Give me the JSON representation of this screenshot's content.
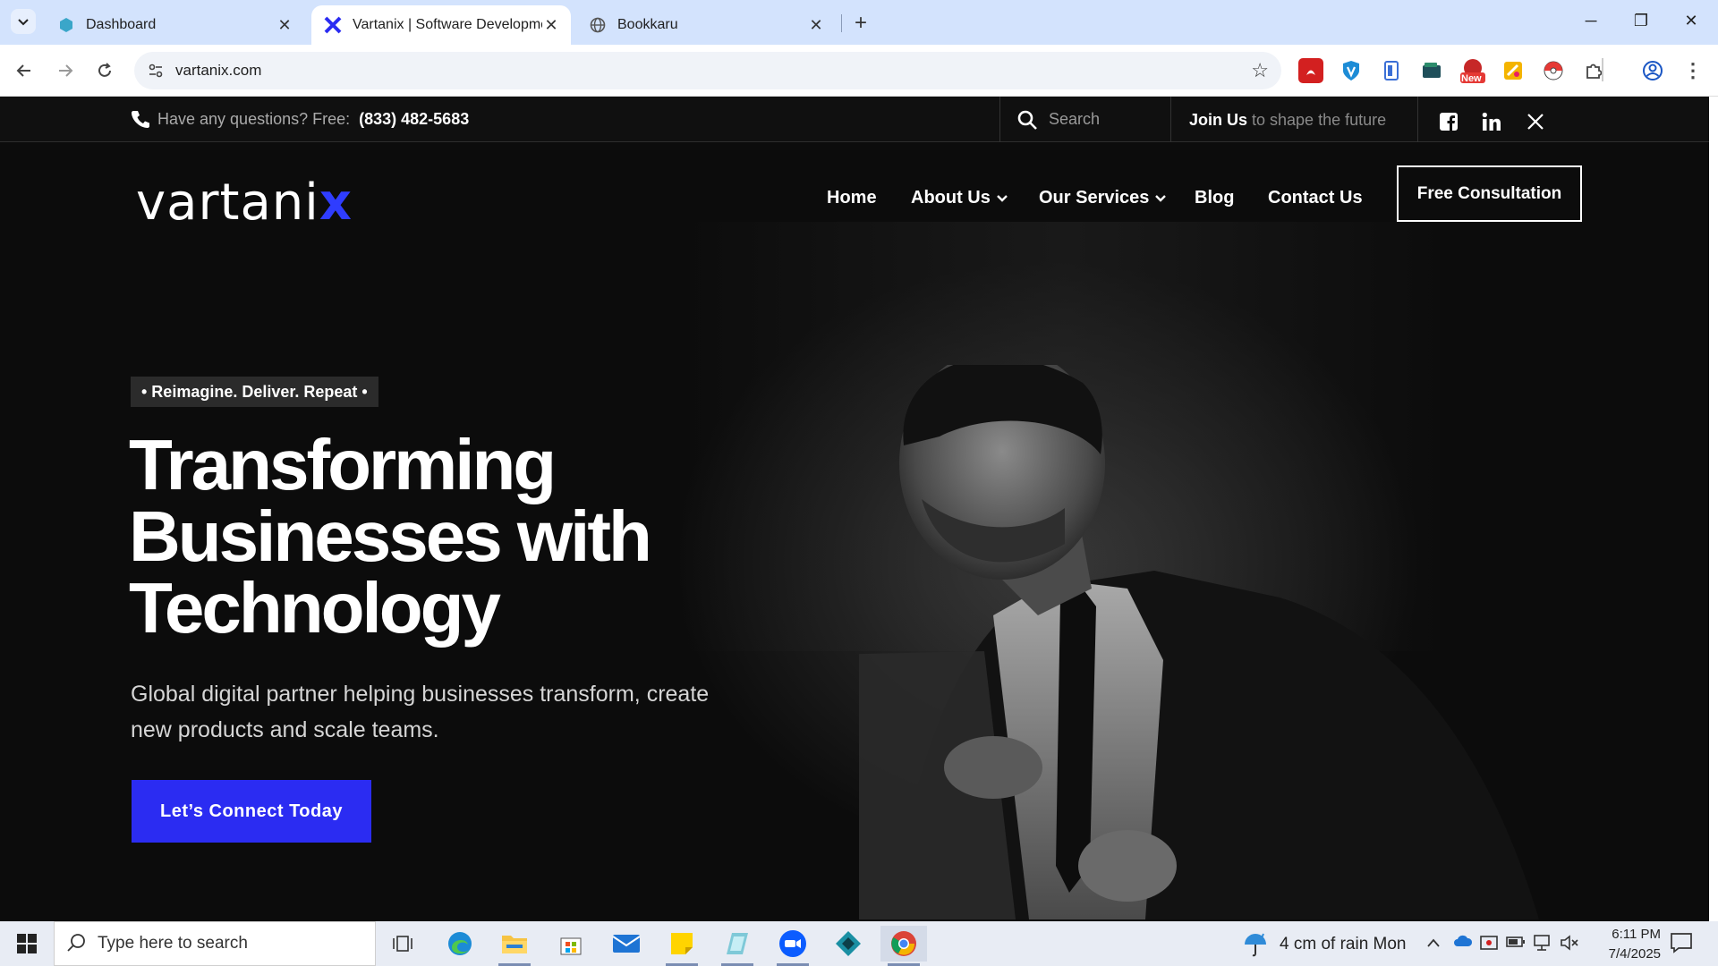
{
  "browser": {
    "tabs": [
      {
        "title": "Dashboard",
        "active": false
      },
      {
        "title": "Vartanix | Software Developmen",
        "active": true
      },
      {
        "title": "Bookkaru",
        "active": false
      }
    ],
    "url": "vartanix.com",
    "extension_badge": "New"
  },
  "site": {
    "topbar": {
      "question": "Have any questions? Free:",
      "phone": "(833) 482-5683",
      "search_placeholder": "Search",
      "join_bold": "Join Us",
      "join_rest": " to shape the future"
    },
    "logo": {
      "main": "vartani",
      "accent": "x"
    },
    "nav": {
      "home": "Home",
      "about": "About Us",
      "services": "Our Services",
      "blog": "Blog",
      "contact": "Contact Us",
      "cta": "Free Consultation"
    },
    "hero": {
      "tagline": "• Reimagine. Deliver. Repeat •",
      "headline_1": "Transforming",
      "headline_2": "Businesses with",
      "headline_3": "Technology",
      "subtext": "Global digital partner helping businesses transform, create new products and scale teams.",
      "cta": "Let’s Connect Today"
    }
  },
  "taskbar": {
    "search_placeholder": "Type here to search",
    "weather": "4 cm of rain Mon",
    "time": "6:11 PM",
    "date": "7/4/2025"
  },
  "colors": {
    "accent": "#2b2cf2",
    "tabbar": "#d3e3fd",
    "page_bg": "#0c0c0c"
  }
}
